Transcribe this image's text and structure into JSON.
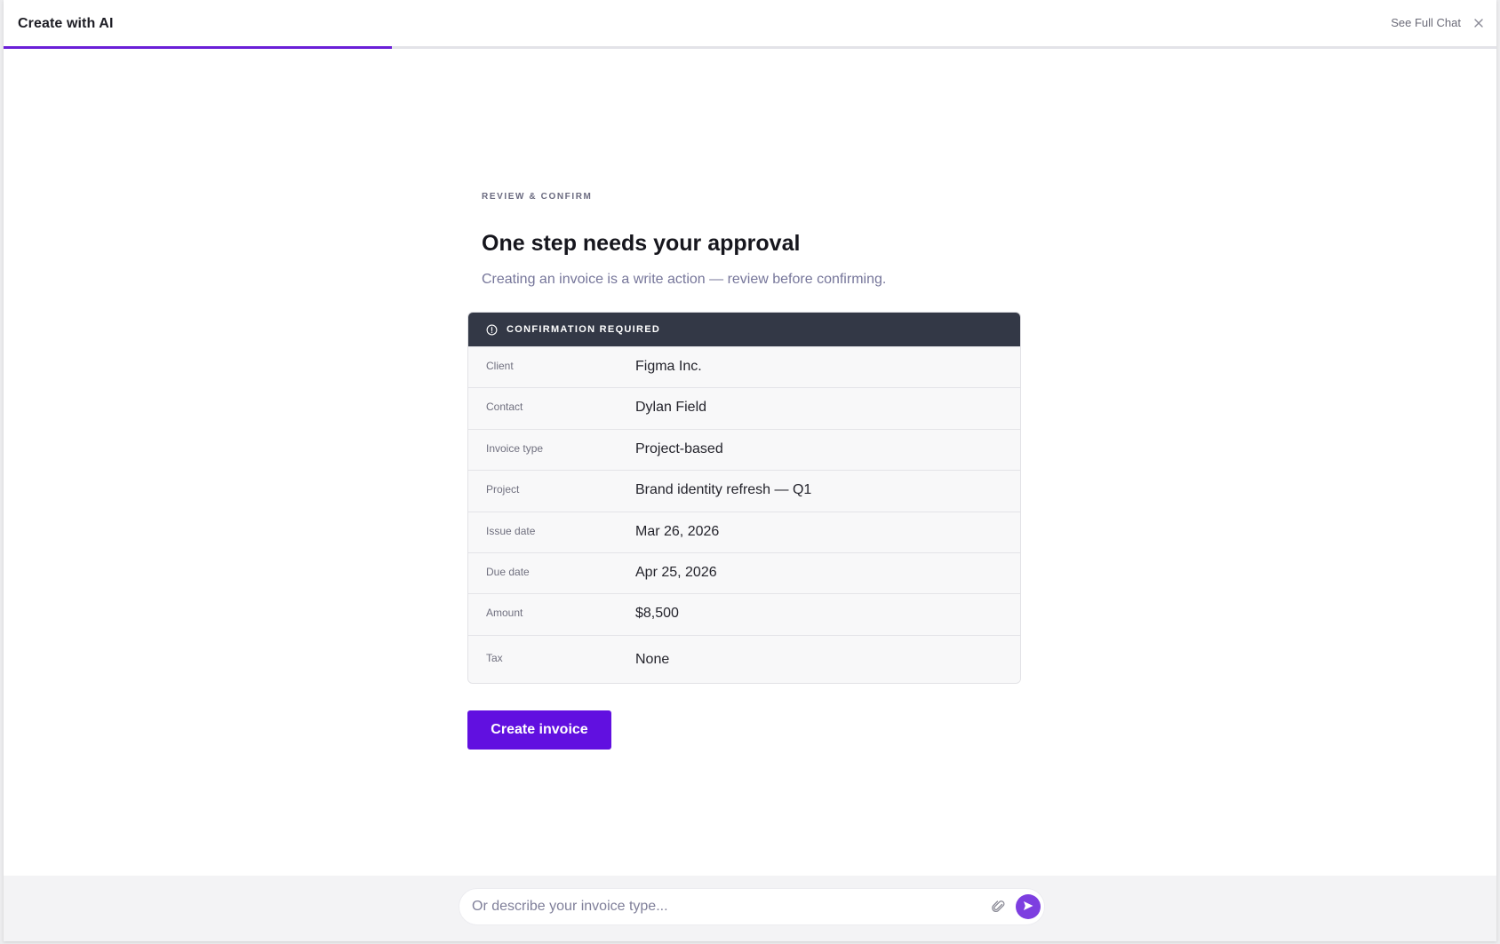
{
  "header": {
    "title": "Create with AI",
    "see_full_chat": "See Full Chat",
    "progress_fraction": 0.26
  },
  "main": {
    "eyebrow": "REVIEW & CONFIRM",
    "title": "One step needs your approval",
    "subtitle": "Creating an invoice is a write action — review before confirming."
  },
  "card": {
    "header_label": "CONFIRMATION REQUIRED",
    "rows": [
      {
        "label": "Client",
        "value": "Figma Inc."
      },
      {
        "label": "Contact",
        "value": "Dylan Field"
      },
      {
        "label": "Invoice type",
        "value": "Project-based"
      },
      {
        "label": "Project",
        "value": "Brand identity refresh — Q1"
      },
      {
        "label": "Issue date",
        "value": "Mar 26, 2026"
      },
      {
        "label": "Due date",
        "value": "Apr 25, 2026"
      },
      {
        "label": "Amount",
        "value": "$8,500"
      },
      {
        "label": "Tax",
        "value": "None"
      }
    ]
  },
  "actions": {
    "create_label": "Create invoice"
  },
  "composer": {
    "placeholder": "Or describe your invoice type...",
    "value": ""
  },
  "colors": {
    "accent": "#6110e0",
    "card_header": "#333846",
    "send_button": "#7d3ee0"
  },
  "icons": {
    "close": "close-icon",
    "info": "info-icon",
    "attach": "paperclip-icon",
    "send": "send-icon"
  }
}
